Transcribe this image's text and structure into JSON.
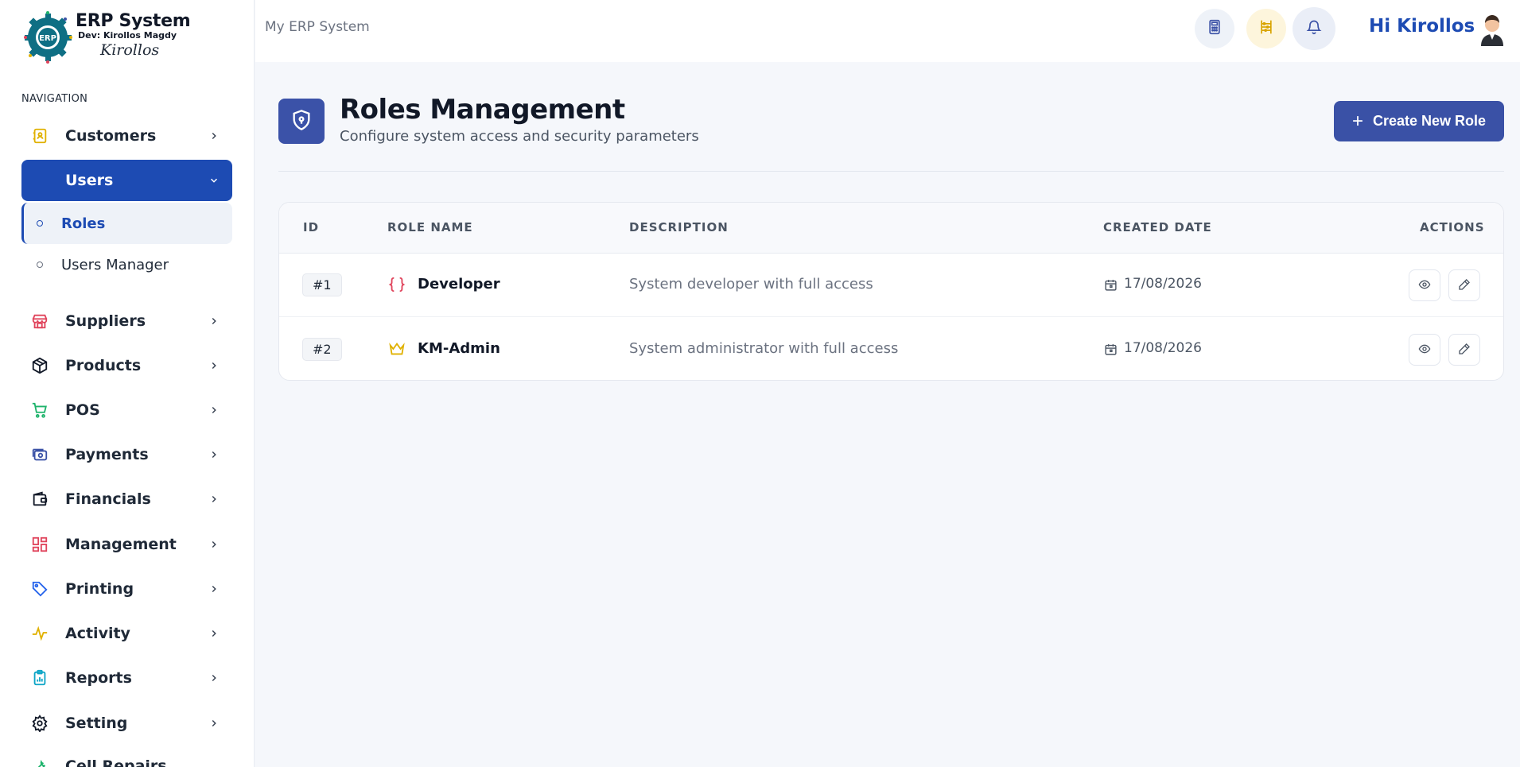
{
  "brand": {
    "title": "ERP System",
    "dev": "Dev: Kirollos Magdy",
    "signature": "Kirollos",
    "logo_text": "ERP"
  },
  "sidebar": {
    "heading": "NAVIGATION",
    "items": [
      {
        "label": "Customers",
        "icon": "contacts-book-icon",
        "color": "#e0b100"
      },
      {
        "label": "Users",
        "icon": "users-icon",
        "color": "#ffffff"
      },
      {
        "label": "Suppliers",
        "icon": "store-icon",
        "color": "#e0435b"
      },
      {
        "label": "Products",
        "icon": "box-icon",
        "color": "#111827"
      },
      {
        "label": "POS",
        "icon": "cart-icon",
        "color": "#1db36b"
      },
      {
        "label": "Payments",
        "icon": "card-payment-icon",
        "color": "#3a51a6"
      },
      {
        "label": "Financials",
        "icon": "wallet-icon",
        "color": "#111827"
      },
      {
        "label": "Management",
        "icon": "dashboard-grid-icon",
        "color": "#e0435b"
      },
      {
        "label": "Printing",
        "icon": "tag-icon",
        "color": "#2563eb"
      },
      {
        "label": "Activity",
        "icon": "activity-icon",
        "color": "#e0b100"
      },
      {
        "label": "Reports",
        "icon": "clipboard-chart-icon",
        "color": "#0ea5c6"
      },
      {
        "label": "Setting",
        "icon": "gear-icon",
        "color": "#111827"
      },
      {
        "label": "Cell Repairs",
        "icon": "wrench-icon",
        "color": "#1db36b"
      }
    ],
    "sub_items": [
      {
        "label": "Roles"
      },
      {
        "label": "Users Manager"
      }
    ]
  },
  "topbar": {
    "breadcrumb": "My ERP System",
    "greeting": "Hi Kirollos"
  },
  "page": {
    "title": "Roles Management",
    "subtitle": "Configure system access and security parameters",
    "create_label": "Create New Role"
  },
  "table": {
    "columns": {
      "id": "ID",
      "role_name": "ROLE NAME",
      "description": "DESCRIPTION",
      "created": "CREATED DATE",
      "actions": "ACTIONS"
    },
    "rows": [
      {
        "id": "#1",
        "name": "Developer",
        "icon": "code-braces-icon",
        "description": "System developer with full access",
        "created": "17/08/2026"
      },
      {
        "id": "#2",
        "name": "KM-Admin",
        "icon": "crown-icon",
        "description": "System administrator with full access",
        "created": "17/08/2026"
      }
    ]
  },
  "colors": {
    "accent": "#1d4bb3",
    "button": "#3a51a6",
    "background": "#f5f7fb"
  }
}
